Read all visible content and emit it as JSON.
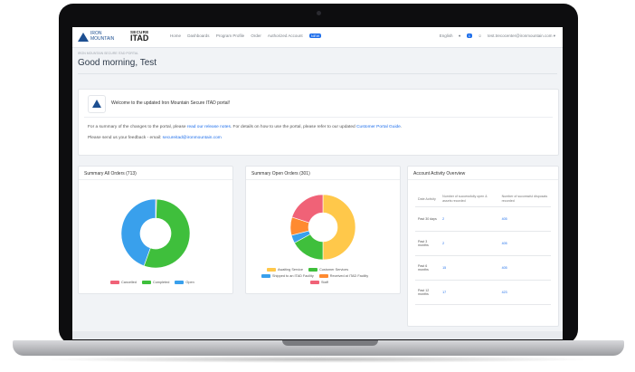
{
  "header": {
    "logo_iron": "IRON MOUNTAIN",
    "logo_secure": "SECURE",
    "logo_itad": "ITAD",
    "nav": [
      "Home",
      "Dashboards",
      "Program Profile",
      "Order",
      "Authorized Account"
    ],
    "nav_badge": "NEW",
    "language": "English",
    "notification_count": "1",
    "user": "test.trecocenter@ironmountain.com"
  },
  "page": {
    "breadcrumb": "IRON MOUNTAIN SECURE ITAD PORTAL",
    "greeting": "Good morning, Test"
  },
  "welcome": {
    "title": "Welcome to the updated Iron Mountain Secure ITAD portal!",
    "line1_a": "For a summary of the changes to the portal, please ",
    "line1_link1": "read our release notes",
    "line1_b": ". For details on how to use the portal, please refer to our updated ",
    "line1_link2": "Customer Portal Guide",
    "line1_c": ".",
    "line2_a": "Please send us your feedback - email: ",
    "line2_link": "secureitad@ironmountain.com"
  },
  "summary_all": {
    "title": "Summary All Orders (713)",
    "legend": [
      "Cancelled",
      "Completed",
      "Open"
    ]
  },
  "summary_open": {
    "title": "Summary Open Orders (301)",
    "legend": [
      "Awaiting Service",
      "Customer Services",
      "Shipped to an ITAD Facility",
      "Received at ITAD Facility",
      "Staff"
    ]
  },
  "account": {
    "title": "Account Activity Overview",
    "headers": [
      "Date Activity",
      "Number of successfully open & assets recorded",
      "Number of successful disposals recorded"
    ],
    "rows": [
      {
        "period": "Past 30 days",
        "orders": "2",
        "assets": "405"
      },
      {
        "period": "Past 3 months",
        "orders": "2",
        "assets": "405"
      },
      {
        "period": "Past 6 months",
        "orders": "15",
        "assets": "405"
      },
      {
        "period": "Past 12 months",
        "orders": "17",
        "assets": "423"
      }
    ]
  },
  "chart_data": [
    {
      "type": "pie",
      "title": "Summary All Orders (713)",
      "categories": [
        "Cancelled",
        "Completed",
        "Open"
      ],
      "values": [
        0.5,
        55,
        44.5
      ],
      "colors": [
        "#f06277",
        "#3fbf3c",
        "#39a0ec"
      ],
      "legend": "bottom"
    },
    {
      "type": "pie",
      "title": "Summary Open Orders (301)",
      "categories": [
        "Awaiting Service",
        "Customer Services",
        "Shipped to an ITAD Facility",
        "Received at ITAD Facility",
        "Staff"
      ],
      "values": [
        50,
        17,
        4,
        9,
        20
      ],
      "colors": [
        "#ffc84a",
        "#3fbf3c",
        "#39a0ec",
        "#ff8a30",
        "#f06277"
      ],
      "legend": "bottom"
    }
  ]
}
